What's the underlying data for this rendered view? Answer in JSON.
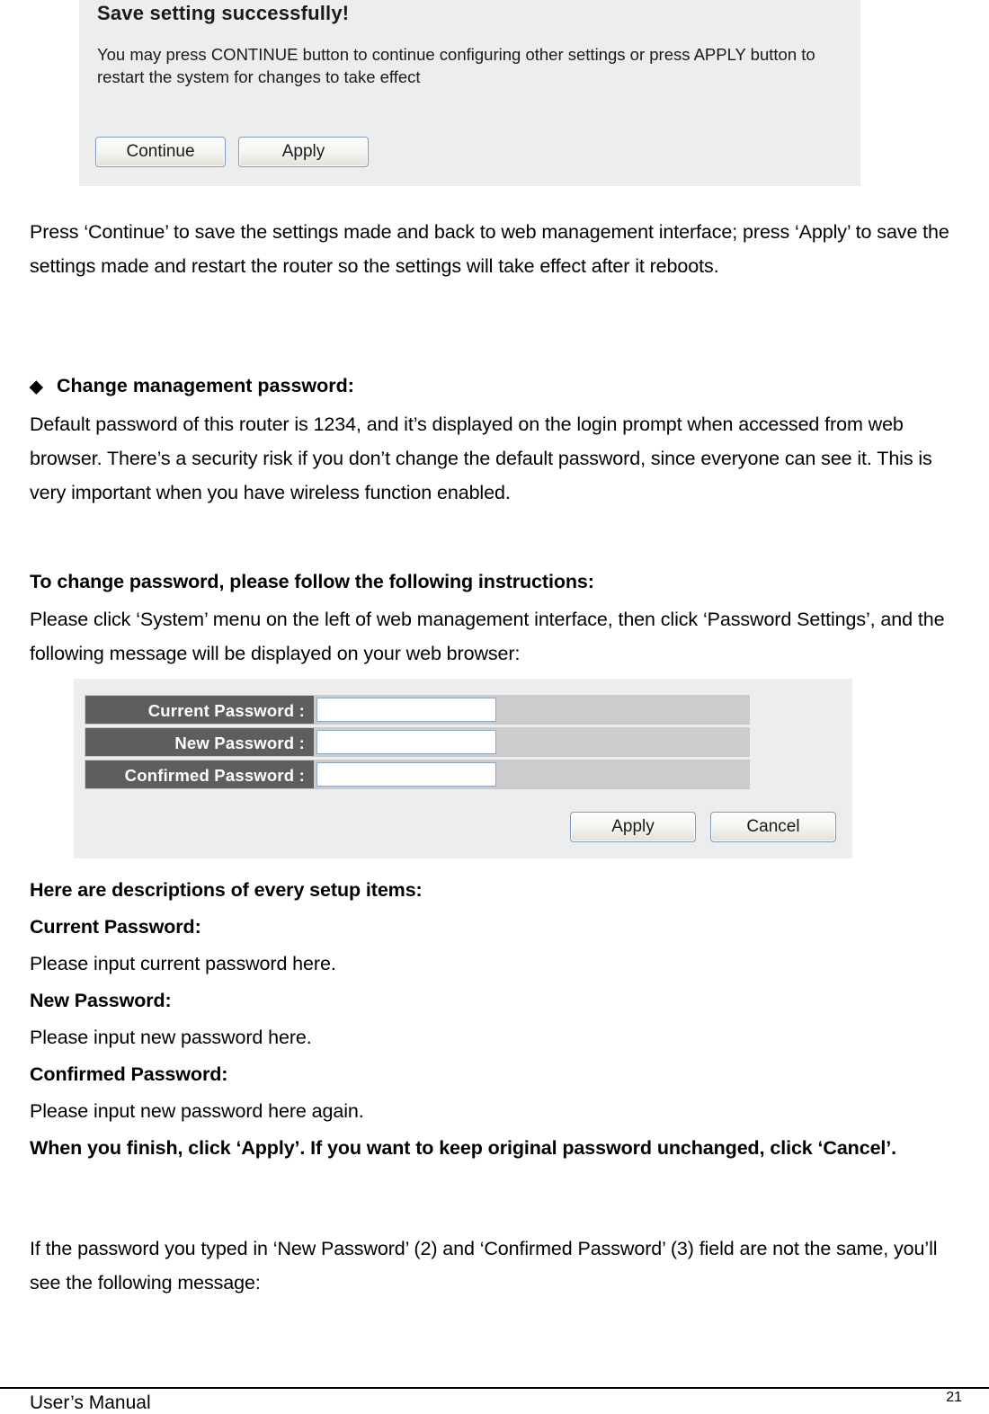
{
  "document": {
    "page_number": "21",
    "footer_label": "User’s Manual"
  },
  "save_panel": {
    "title": "Save setting successfully!",
    "message": "You may press CONTINUE button to continue configuring other settings or press APPLY button to restart the system for changes to take effect",
    "continue_button": "Continue",
    "apply_button": "Apply"
  },
  "paragraphs": {
    "after_save_panel": "Press ‘Continue’ to save the settings made and back to web management interface; press ‘Apply’ to save the settings made and restart the router so the settings will take effect after it reboots.",
    "change_password_heading_bullet": "◆",
    "change_password_heading": "Change management password:",
    "change_password_body": "Default password of this router is 1234, and it’s displayed on the login prompt when accessed from web browser. There’s a security risk if you don’t change the default password, since everyone can see it. This is very important when you have wireless function enabled.",
    "instructions_heading": "To change password, please follow the following instructions:",
    "instructions_body": "Please click ‘System’ menu on the left of web management interface, then click ‘Password Settings’, and the following message will be displayed on your web browser:",
    "descriptions_heading": "Here are descriptions of every setup items:",
    "current_password_term": "Current Password:",
    "current_password_desc": "Please input current password here.",
    "new_password_term": "New Password:",
    "new_password_desc": "Please input new password here.",
    "confirmed_password_term": "Confirmed Password:",
    "confirmed_password_desc": "Please input new password here again.",
    "finish_note": "When you finish, click ‘Apply’. If you want to keep original password unchanged, click ‘Cancel’.",
    "mismatch_note": "If the password you typed in ‘New Password’ (2) and ‘Confirmed Password’ (3) field are not the same, you’ll see the following message:"
  },
  "password_panel": {
    "rows": [
      {
        "label": "Current Password :",
        "value": ""
      },
      {
        "label": "New Password :",
        "value": ""
      },
      {
        "label": "Confirmed Password :",
        "value": ""
      }
    ],
    "apply_button": "Apply",
    "cancel_button": "Cancel"
  },
  "colors": {
    "panel_background": "#ededed",
    "row_label_background": "#5e5e5e",
    "row_value_background": "#cccccc",
    "input_border": "#8aa6c2",
    "button_border": "#7d9bbb"
  }
}
